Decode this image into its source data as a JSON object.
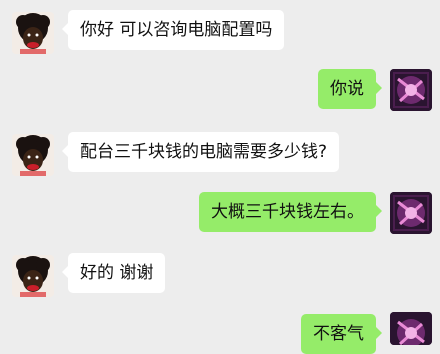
{
  "chat": {
    "colors": {
      "background": "#ededed",
      "incoming_bubble": "#ffffff",
      "outgoing_bubble": "#95ec69"
    },
    "messages": [
      {
        "side": "left",
        "avatar": "contact-avatar",
        "text": "你好 可以咨询电脑配置吗"
      },
      {
        "side": "right",
        "avatar": "self-avatar",
        "text": "你说"
      },
      {
        "side": "left",
        "avatar": "contact-avatar",
        "text": "配台三千块钱的电脑需要多少钱?"
      },
      {
        "side": "right",
        "avatar": "self-avatar",
        "text": "大概三千块钱左右。"
      },
      {
        "side": "left",
        "avatar": "contact-avatar",
        "text": "好的 谢谢"
      },
      {
        "side": "right",
        "avatar": "self-avatar",
        "text": "不客气"
      }
    ]
  }
}
